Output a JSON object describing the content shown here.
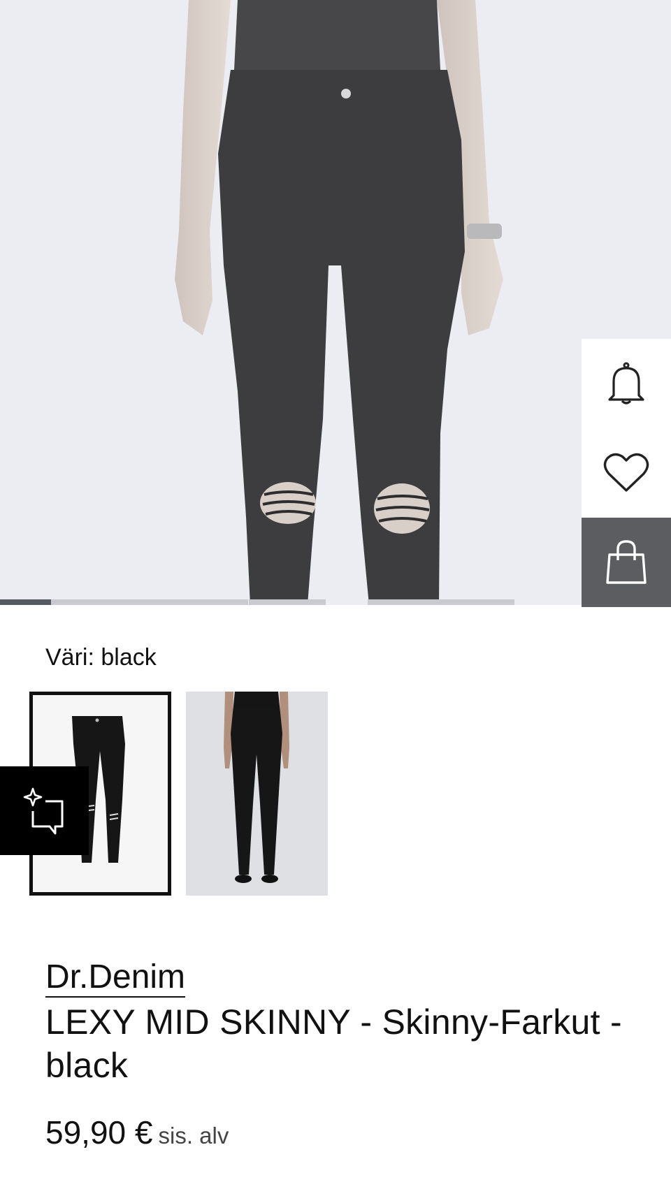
{
  "gallery": {
    "image_alt": "Model wearing black skinny jeans with ripped knees",
    "slide_count": 5,
    "active_slide": 1
  },
  "actions": {
    "notify_icon": "bell-icon",
    "wishlist_icon": "heart-icon",
    "cart_icon": "shopping-bag-icon"
  },
  "product": {
    "color_label": "Väri: black",
    "thumbnails": [
      {
        "icon": "jeans-packshot",
        "selected": true
      },
      {
        "icon": "model-full-body",
        "selected": false
      }
    ],
    "brand": "Dr.Denim",
    "title": "LEXY MID SKINNY - Skinny-Farkut - black",
    "price": "59,90 €",
    "vat_note": "sis. alv"
  },
  "ai_assistant": {
    "icon": "ai-sparkle-chat-icon"
  },
  "colors": {
    "text": "#111111",
    "rail_dark": "#5b5d60",
    "hero_bg": "#ebedf2"
  }
}
